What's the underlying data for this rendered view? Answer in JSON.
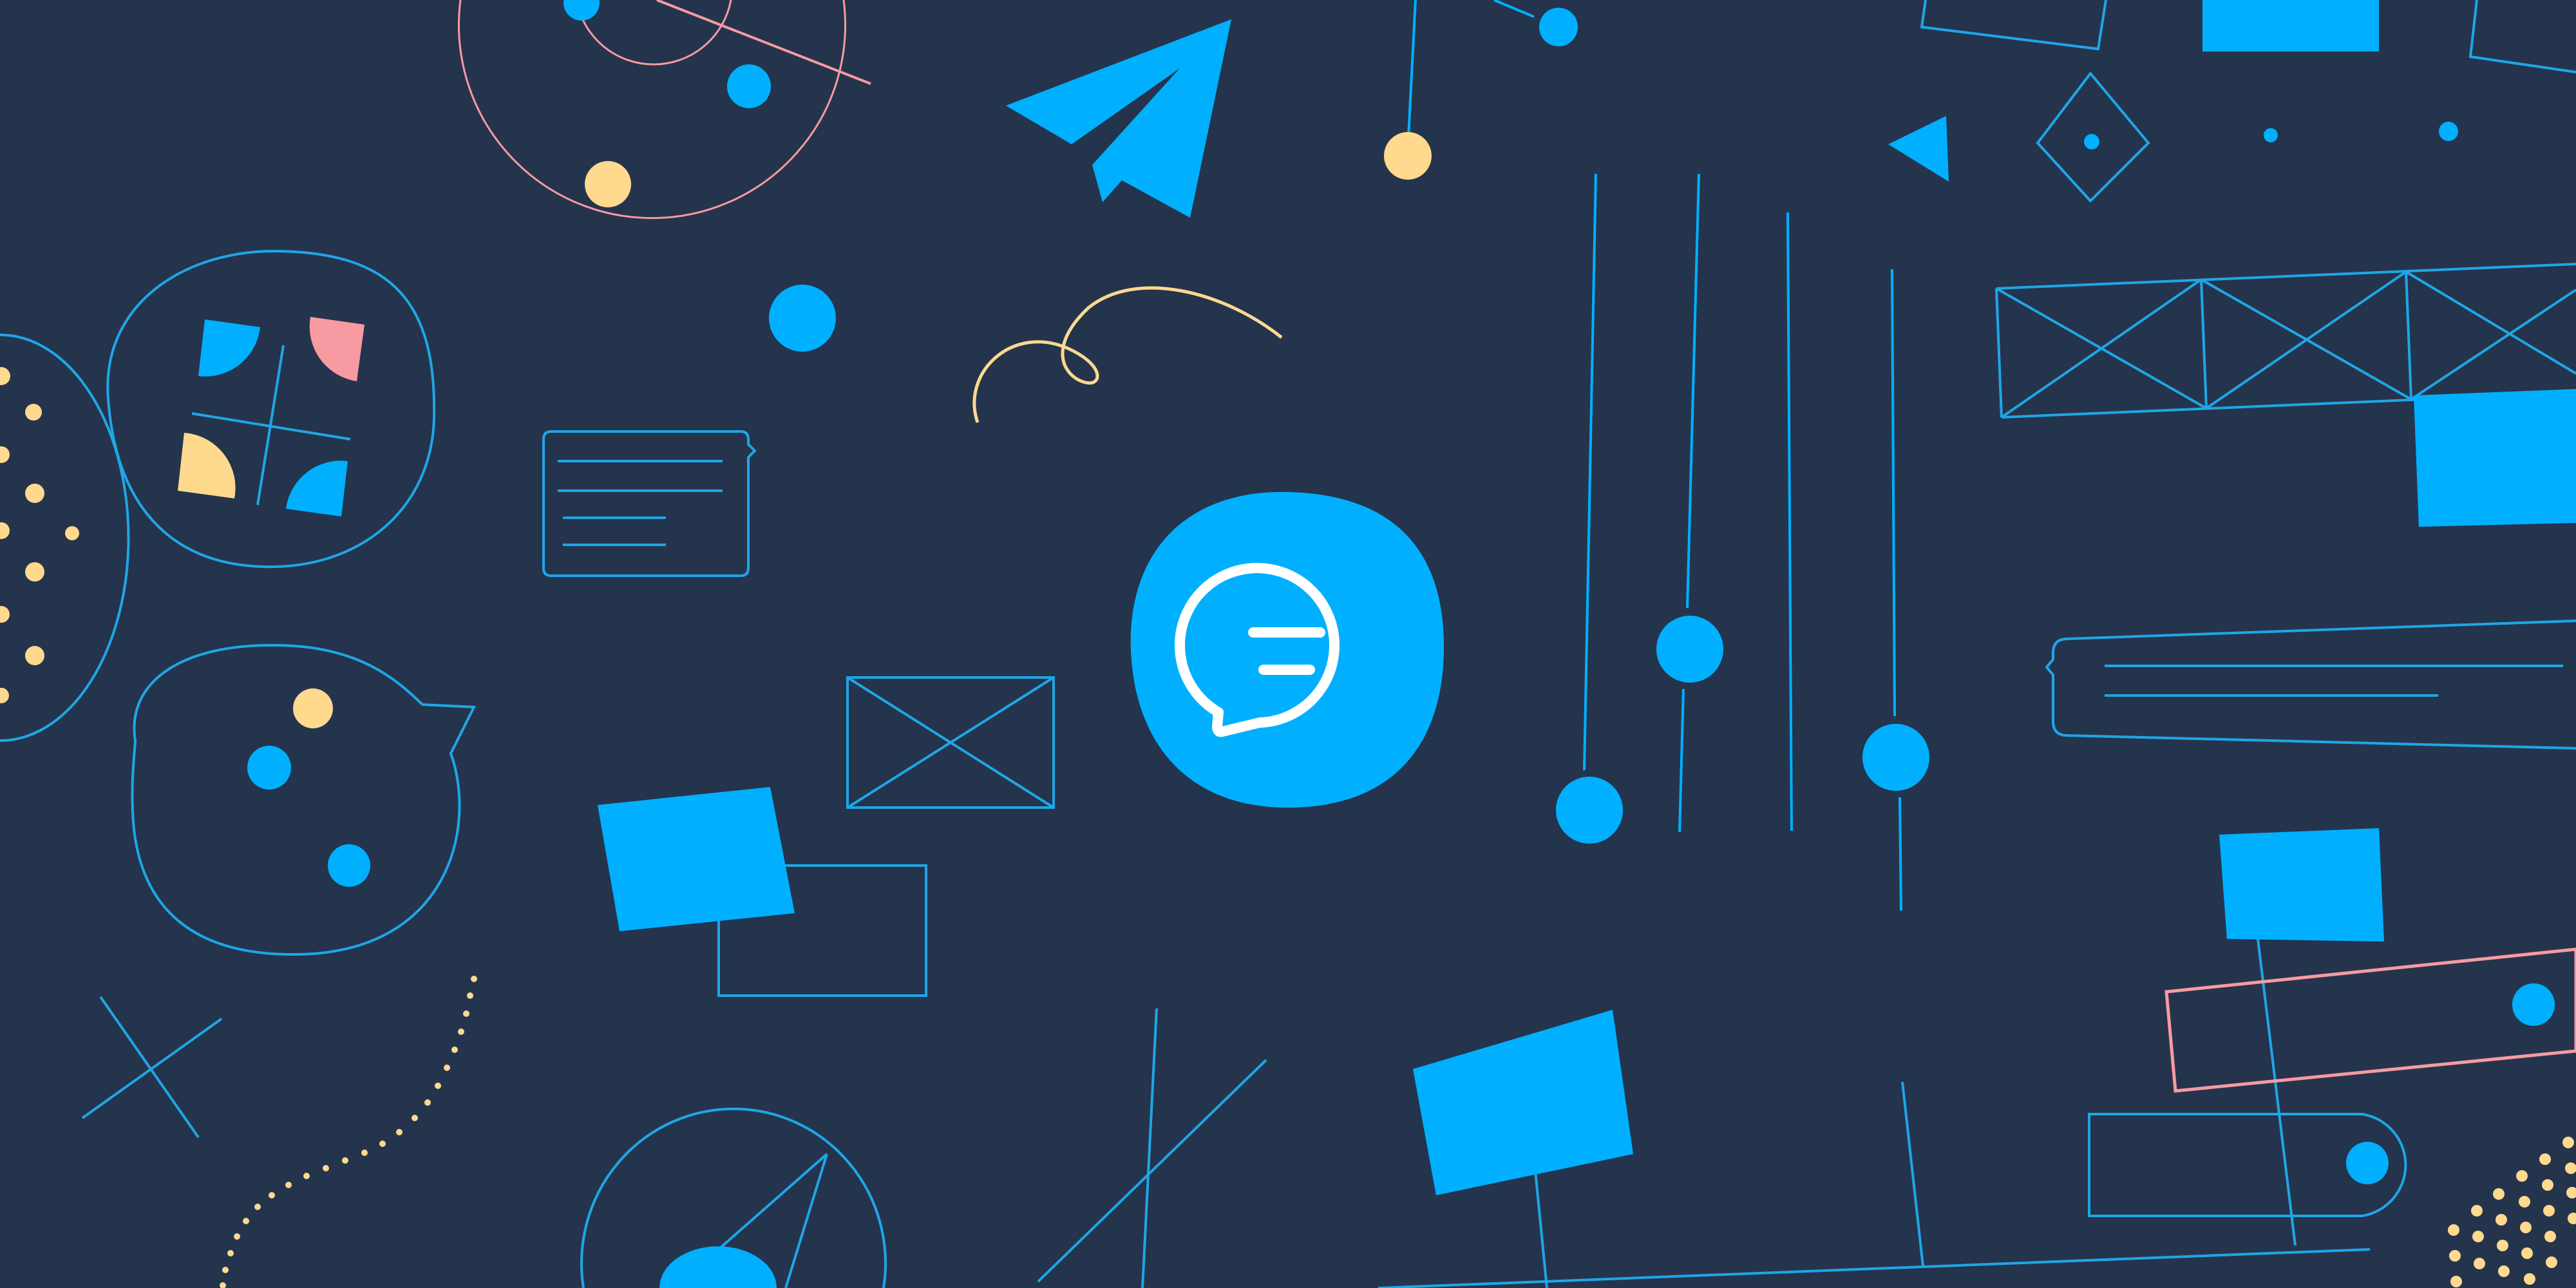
{
  "colors": {
    "background": "#24344d",
    "accent_blue": "#00b0ff",
    "line_blue": "#1fa6e6",
    "yellow": "#ffd98e",
    "pink": "#f79aa2",
    "icon_white": "#ffffff"
  },
  "central_badge": {
    "icon": "chat-bubble-icon"
  },
  "icons": [
    "chat-bubble-icon",
    "paper-plane-icon",
    "pie-grid-icon",
    "speech-bubble-outline-icon",
    "image-placeholder-icon",
    "text-card-icon",
    "orbit-icon",
    "diamond-icon",
    "triangle-icon",
    "slider-icon",
    "toggle-switch-icon"
  ]
}
